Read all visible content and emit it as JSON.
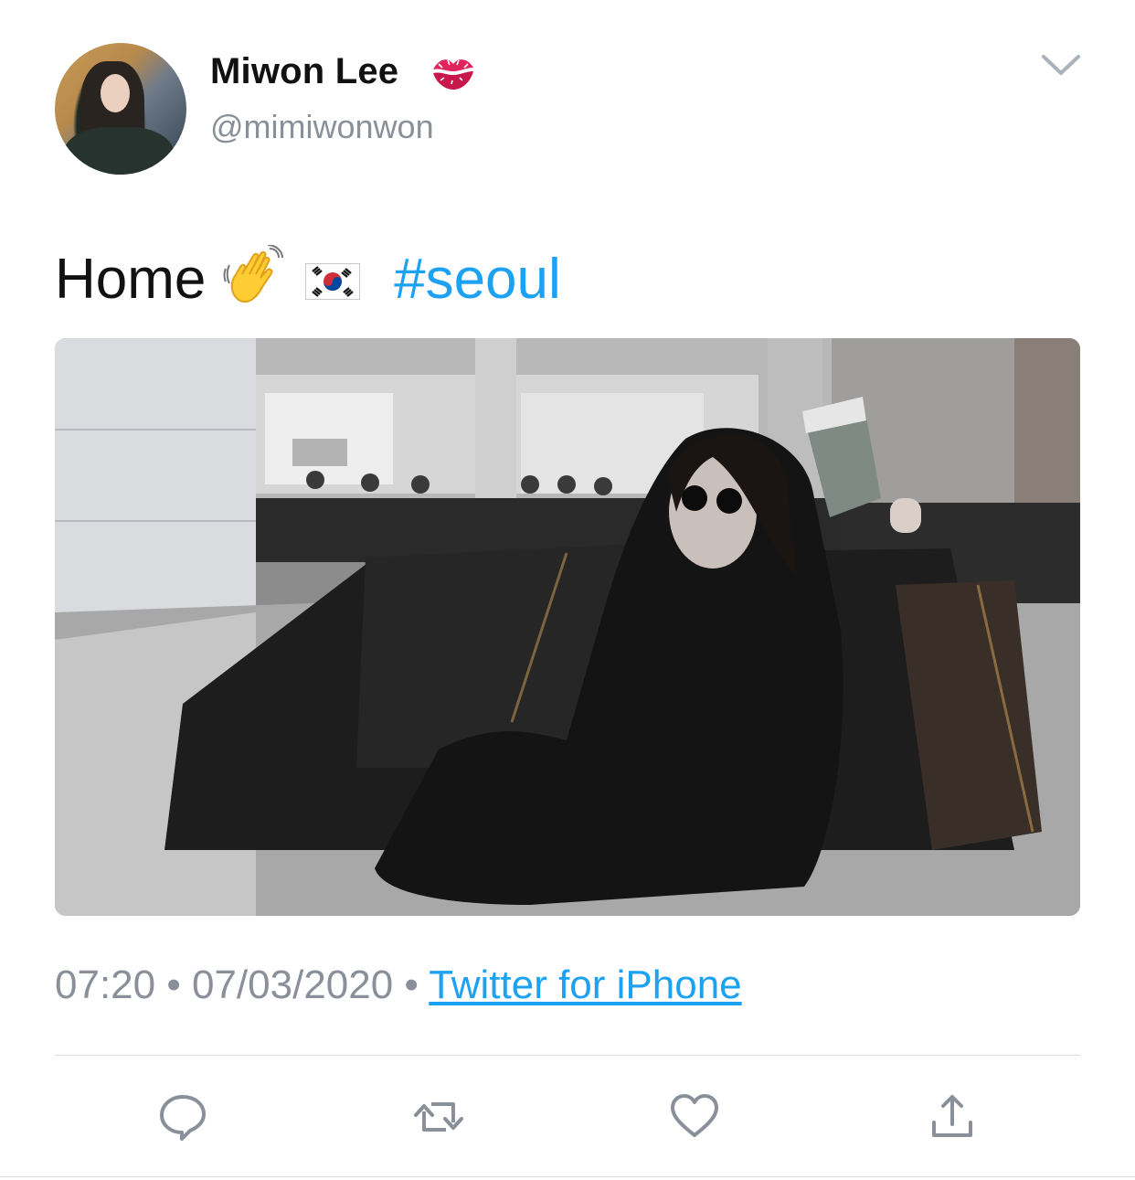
{
  "author": {
    "display_name": "Miwon Lee",
    "badge_emoji": "kiss-mark-icon",
    "handle": "@mimiwonwon"
  },
  "tweet": {
    "text": "Home",
    "emojis": [
      "waving-hand-icon",
      "south-korea-flag-icon"
    ],
    "hashtag": "#seoul"
  },
  "meta": {
    "time": "07:20",
    "separator": "•",
    "date": "07/03/2020",
    "source": "Twitter for iPhone"
  },
  "actions": [
    "reply-icon",
    "retweet-icon",
    "like-icon",
    "share-icon"
  ],
  "colors": {
    "link": "#1da1f2",
    "muted": "#8a9099",
    "text": "#111111",
    "divider": "#d8dde2"
  }
}
